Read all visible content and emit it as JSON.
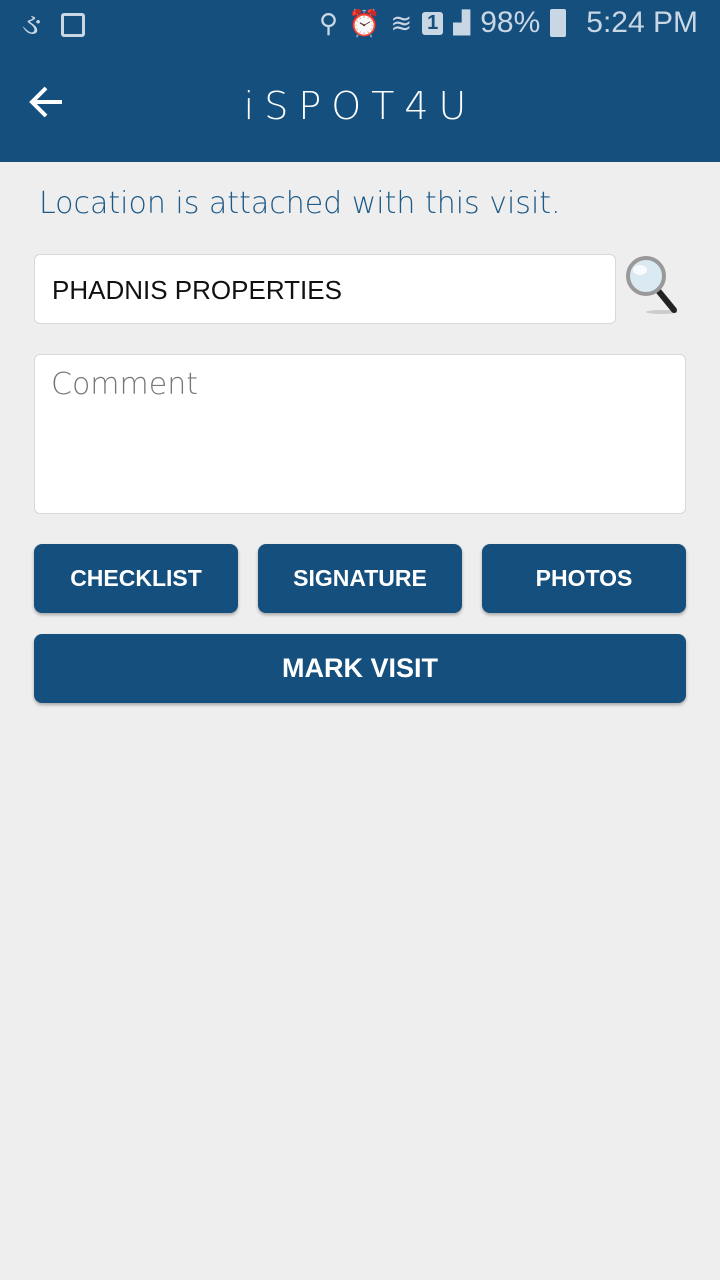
{
  "status_bar": {
    "battery": "98%",
    "time": "5:24 PM",
    "icons": [
      "app-notification-icon",
      "image-icon",
      "location-icon",
      "alarm-icon",
      "wifi-icon",
      "sim-1-icon",
      "signal-icon",
      "battery-icon"
    ]
  },
  "app_bar": {
    "title": "iSPOT4U",
    "back_icon": "arrow-left-icon"
  },
  "message": "Location is attached with this visit.",
  "location_field": {
    "value": "PHADNIS PROPERTIES"
  },
  "comment_field": {
    "value": "",
    "placeholder": "Comment"
  },
  "buttons": {
    "checklist": "CHECKLIST",
    "signature": "SIGNATURE",
    "photos": "PHOTOS",
    "mark_visit": "MARK VISIT"
  },
  "colors": {
    "primary": "#144f7d",
    "background": "#eeeeee"
  }
}
